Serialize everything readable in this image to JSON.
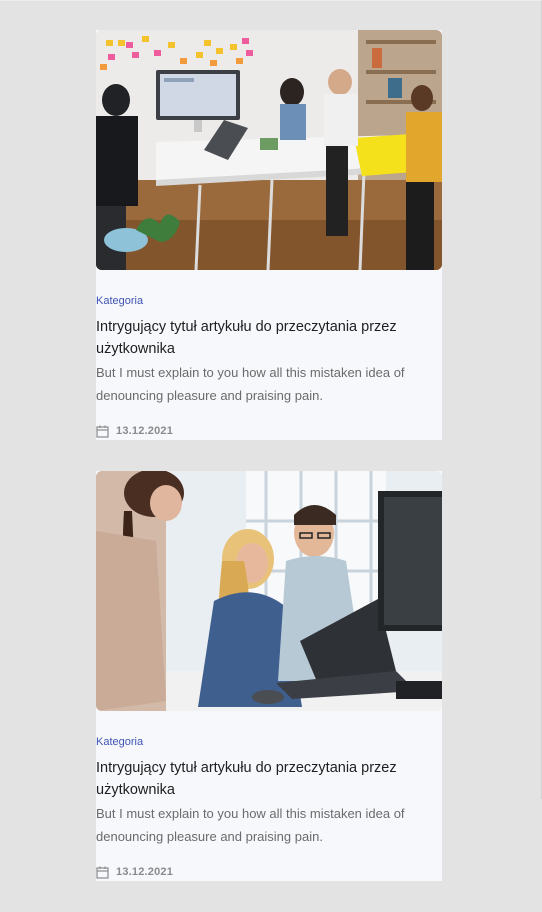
{
  "articles": [
    {
      "image": "team-meeting-photo",
      "category": "Kategoria",
      "title": "Intrygujący tytuł artykułu do przeczytania przez użytkownika",
      "excerpt": "But I must explain to you how all this mistaken idea of denouncing pleasure and praising pain.",
      "date_icon": "calendar-icon",
      "date": "13.12.2021"
    },
    {
      "image": "office-laptop-photo",
      "category": "Kategoria",
      "title": "Intrygujący tytuł artykułu do przeczytania przez użytkownika",
      "excerpt": "But I must explain to you how all this mistaken idea of denouncing pleasure and praising pain.",
      "date_icon": "calendar-icon",
      "date": "13.12.2021"
    }
  ]
}
